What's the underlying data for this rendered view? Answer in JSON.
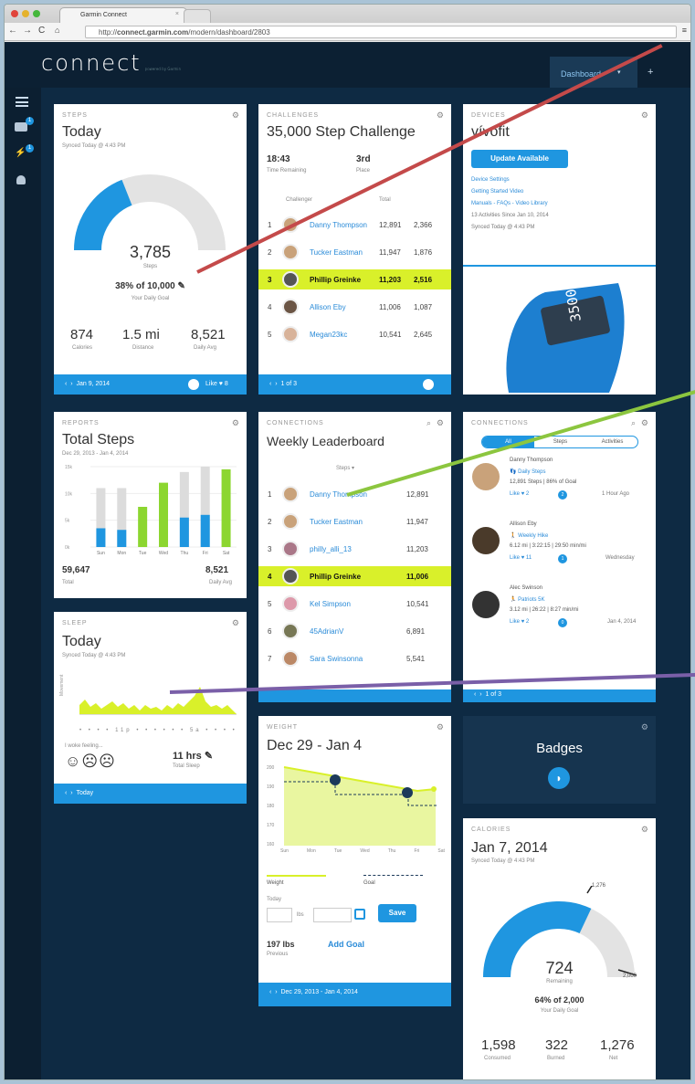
{
  "browser": {
    "tab_title": "Garmin Connect",
    "url_prefix": "http://",
    "url_host": "connect.garmin.com",
    "url_path": "/modern/dashboard/2803"
  },
  "app": {
    "logo": "connect",
    "logo_tagline": "powered by Garmin",
    "nav_tab": "Dashboard",
    "nav_add": "+",
    "sidebar_badges": [
      "1",
      "1"
    ]
  },
  "colors": {
    "accent": "#1f96e0",
    "highlight": "#d9f02a",
    "green": "#8cd630",
    "dark": "#0e2a43",
    "pointer_red": "#c44a4a",
    "pointer_green": "#8cc63f",
    "pointer_purple": "#7a5fa8"
  },
  "steps": {
    "header": "STEPS",
    "title": "Today",
    "synced": "Synced Today @ 4:43 PM",
    "value": "3,785",
    "value_label": "Steps",
    "goal": "38% of 10,000",
    "goal_label": "Your Daily Goal",
    "progress": 0.38,
    "stats": [
      {
        "value": "874",
        "label": "Calories"
      },
      {
        "value": "1.5 mi",
        "label": "Distance"
      },
      {
        "value": "8,521",
        "label": "Daily Avg"
      }
    ],
    "footer_date": "Jan 9, 2014",
    "footer_like": "Like ♥ 8"
  },
  "challenge": {
    "header": "CHALLENGES",
    "title": "35,000 Step Challenge",
    "time": "18:43",
    "time_label": "Time Remaining",
    "place": "3rd",
    "place_label": "Place",
    "col_challenger": "Challenger",
    "col_total": "Total",
    "rows": [
      {
        "rank": "1",
        "name": "Danny Thompson",
        "total": "12,891",
        "today": "2,366"
      },
      {
        "rank": "2",
        "name": "Tucker Eastman",
        "total": "11,947",
        "today": "1,876"
      },
      {
        "rank": "3",
        "name": "Phillip Greinke",
        "total": "11,203",
        "today": "2,516"
      },
      {
        "rank": "4",
        "name": "Allison Eby",
        "total": "11,006",
        "today": "1,087"
      },
      {
        "rank": "5",
        "name": "Megan23kc",
        "total": "10,541",
        "today": "2,645"
      }
    ],
    "footer_page": "1 of 3"
  },
  "devices": {
    "header": "DEVICES",
    "title": "vívofit",
    "button": "Update Available",
    "links": [
      "Device Settings",
      "Getting Started Video",
      "Manuals - FAQs - Video Library"
    ],
    "activities": "13 Activities Since Jan 10, 2014",
    "synced": "Synced Today @ 4:43 PM",
    "band_display": "3500"
  },
  "reports": {
    "header": "REPORTS",
    "title": "Total Steps",
    "range": "Dec 29, 2013 - Jan 4, 2014",
    "yticks": [
      "15k",
      "10k",
      "5k",
      "0k"
    ],
    "total": "59,647",
    "total_label": "Total",
    "avg": "8,521",
    "avg_label": "Daily Avg"
  },
  "chart_data": {
    "type": "bar",
    "categories": [
      "Sun",
      "Mon",
      "Tue",
      "Wed",
      "Thu",
      "Fri",
      "Sat"
    ],
    "series": [
      {
        "values": [
          3500,
          3200,
          7500,
          12000,
          5500,
          6000,
          14500
        ]
      },
      {
        "values": [
          7500,
          7800,
          0,
          0,
          8500,
          9000,
          0
        ]
      }
    ],
    "ylim": [
      0,
      15000
    ]
  },
  "leaderboard": {
    "header": "CONNECTIONS",
    "title": "Weekly Leaderboard",
    "filter": "Steps",
    "rows": [
      {
        "rank": "1",
        "name": "Danny Thompson",
        "value": "12,891"
      },
      {
        "rank": "2",
        "name": "Tucker Eastman",
        "value": "11,947"
      },
      {
        "rank": "3",
        "name": "philly_alli_13",
        "value": "11,203"
      },
      {
        "rank": "4",
        "name": "Phillip Greinke",
        "value": "11,006"
      },
      {
        "rank": "5",
        "name": "Kel Simpson",
        "value": "10,541"
      },
      {
        "rank": "6",
        "name": "45AdrianV",
        "value": "6,891"
      },
      {
        "rank": "7",
        "name": "Sara Swinsonna",
        "value": "5,541"
      }
    ]
  },
  "feed": {
    "header": "CONNECTIONS",
    "tabs": [
      "All",
      "Steps",
      "Activities"
    ],
    "items": [
      {
        "name": "Danny Thompson",
        "activity": "Daily Steps",
        "detail": "12,891 Steps | 86% of Goal",
        "like": "Like ♥ 2",
        "comments": "2",
        "time": "1 Hour Ago"
      },
      {
        "name": "Allison Eby",
        "activity": "Weekly Hike",
        "detail": "6.12 mi | 3:22:15 | 29:50 min/mi",
        "like": "Like ♥ 11",
        "comments": "1",
        "time": "Wednesday"
      },
      {
        "name": "Alec Swinson",
        "activity": "Patriots 5K",
        "detail": "3.12 mi | 26:22 | 8:27 min/mi",
        "like": "Like ♥ 2",
        "comments": "0",
        "time": "Jan 4, 2014"
      }
    ],
    "footer_page": "1 of 3"
  },
  "sleep": {
    "header": "SLEEP",
    "title": "Today",
    "synced": "Synced Today @ 4:43 PM",
    "axis_label": "Movement",
    "tick_mid": "11p",
    "tick_end": "5a",
    "feeling": "I woke feeling...",
    "hours": "11 hrs",
    "hours_label": "Total Sleep",
    "footer": "Today"
  },
  "weight": {
    "header": "WEIGHT",
    "title": "Dec 29 - Jan 4",
    "yticks": [
      "200",
      "190",
      "180",
      "170",
      "160"
    ],
    "days": [
      "Sun",
      "Mon",
      "Tue",
      "Wed",
      "Thu",
      "Fri",
      "Sat"
    ],
    "legend_weight": "Weight",
    "legend_goal": "Goal",
    "today_label": "Today",
    "unit": "lbs",
    "save": "Save",
    "current": "197 lbs",
    "current_label": "Previous",
    "add_goal": "Add Goal",
    "footer": "Dec 29, 2013 - Jan 4, 2014"
  },
  "badges": {
    "title": "Badges"
  },
  "calories": {
    "header": "CALORIES",
    "title": "Jan 7, 2014",
    "synced": "Synced Today @ 4:43 PM",
    "value": "724",
    "value_label": "Remaining",
    "mark_top": "1,276",
    "mark_end": "2,000",
    "goal": "64% of 2,000",
    "goal_label": "Your Daily Goal",
    "progress": 0.64,
    "stats": [
      {
        "value": "1,598",
        "label": "Consumed"
      },
      {
        "value": "322",
        "label": "Burned"
      },
      {
        "value": "1,276",
        "label": "Net"
      }
    ]
  }
}
